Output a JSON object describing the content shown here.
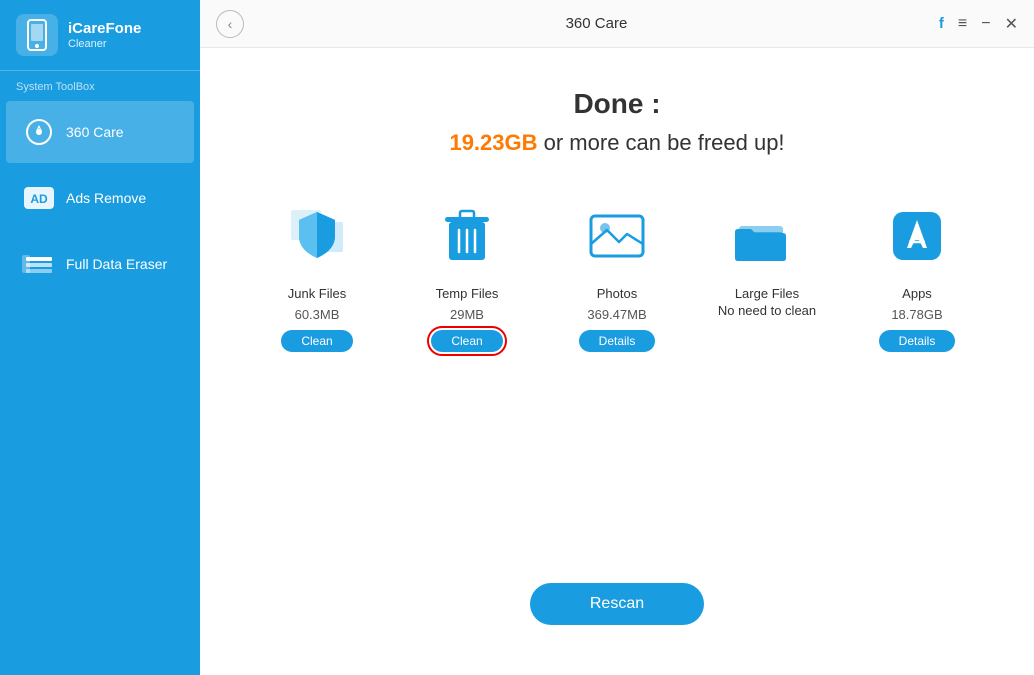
{
  "app": {
    "title": "iCareFone",
    "subtitle": "Cleaner",
    "window_title": "360 Care"
  },
  "sidebar": {
    "section_label": "System ToolBox",
    "items": [
      {
        "id": "360-care",
        "label": "360 Care",
        "active": true
      },
      {
        "id": "ads-remove",
        "label": "Ads Remove",
        "active": false
      },
      {
        "id": "full-data-eraser",
        "label": "Full Data Eraser",
        "active": false
      }
    ]
  },
  "titlebar": {
    "back_icon": "‹",
    "facebook_icon": "f",
    "menu_icon": "≡",
    "minimize_icon": "−",
    "close_icon": "✕"
  },
  "content": {
    "done_label": "Done :",
    "freed_amount": "19.23GB",
    "freed_text": " or more can be freed up!",
    "cards": [
      {
        "id": "junk-files",
        "label": "Junk Files",
        "size": "60.3MB",
        "button": "Clean",
        "highlighted": false
      },
      {
        "id": "temp-files",
        "label": "Temp Files",
        "size": "29MB",
        "button": "Clean",
        "highlighted": true
      },
      {
        "id": "photos",
        "label": "Photos",
        "size": "369.47MB",
        "button": "Details",
        "highlighted": false
      },
      {
        "id": "large-files",
        "label": "Large Files\nNo need to clean",
        "size": "",
        "button": "",
        "highlighted": false
      },
      {
        "id": "apps",
        "label": "Apps",
        "size": "18.78GB",
        "button": "Details",
        "highlighted": false
      }
    ],
    "rescan_label": "Rescan"
  }
}
